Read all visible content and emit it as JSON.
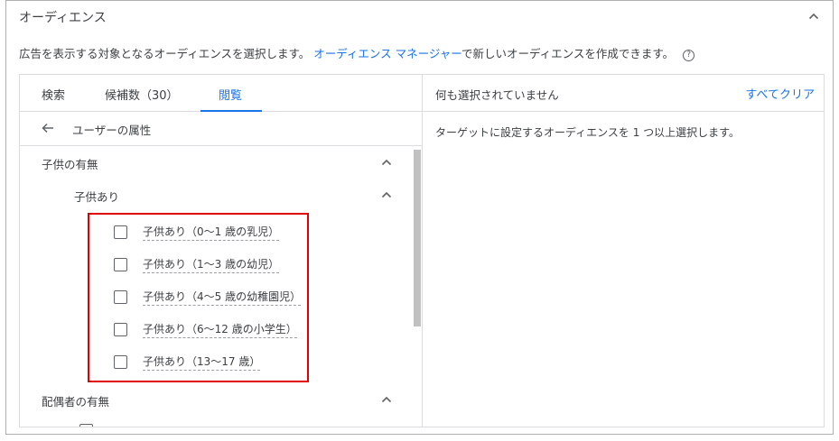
{
  "section": {
    "title": "オーディエンス",
    "desc_before": "広告を表示する対象となるオーディエンスを選択します。",
    "desc_link": "オーディエンス マネージャー",
    "desc_after": "で新しいオーディエンスを作成できます。",
    "help_glyph": "?"
  },
  "tabs": [
    {
      "label": "検索",
      "active": false
    },
    {
      "label": "候補数（30）",
      "active": false
    },
    {
      "label": "閲覧",
      "active": true
    }
  ],
  "breadcrumb": {
    "label": "ユーザーの属性"
  },
  "tree": {
    "group1_label": "子供の有無",
    "sub1_label": "子供あり",
    "options": [
      "子供あり（0～1 歳の乳児）",
      "子供あり（1～3 歳の幼児）",
      "子供あり（4～5 歳の幼稚園児）",
      "子供あり（6～12 歳の小学生）",
      "子供あり（13～17 歳）"
    ],
    "group2_label": "配偶者の有無"
  },
  "selection": {
    "none_text": "何も選択されていません",
    "clear_all_label": "すべてクリア",
    "hint": "ターゲットに設定するオーディエンスを 1 つ以上選択します。"
  },
  "colors": {
    "accent": "#1a73e8",
    "highlight": "#e00000",
    "text": "#3c4043",
    "divider": "#dadce0"
  },
  "icons": {
    "collapse": "chevron-up-icon",
    "back": "arrow-left-icon",
    "help": "help-circle-icon",
    "checkbox": "checkbox-unchecked-icon"
  }
}
